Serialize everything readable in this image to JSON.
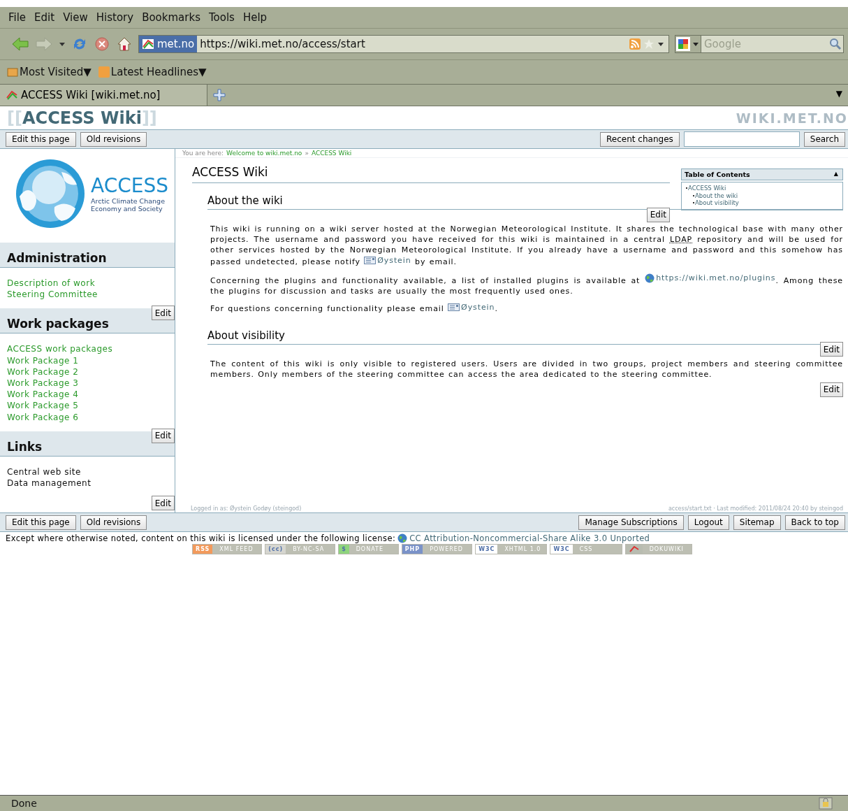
{
  "menu": [
    "File",
    "Edit",
    "View",
    "History",
    "Bookmarks",
    "Tools",
    "Help"
  ],
  "nav": {
    "site": "met.no",
    "url": "https://wiki.met.no/access/start",
    "search_placeholder": "Google"
  },
  "bookmarks": [
    "Most Visited▼",
    "Latest Headlines▼"
  ],
  "tabs": [
    {
      "label": "ACCESS Wiki [wiki.met.no]",
      "selected": true
    }
  ],
  "tab_list_arrow": "▼",
  "wiki": {
    "bracket_open": "[[",
    "title": "ACCESS Wiki",
    "bracket_close": "]]",
    "site_logo": "WIKI.MET.NO"
  },
  "top_left_buttons": [
    "Edit this page",
    "Old revisions"
  ],
  "top_right": {
    "recent": "Recent changes",
    "search_button": "Search"
  },
  "breadcrumb": {
    "label": "You are here:",
    "links": [
      "Welcome to wiki.met.no",
      "ACCESS Wiki"
    ],
    "separator": "»"
  },
  "logo": {
    "name": "ACCESS",
    "line1": "Arctic Climate Change",
    "line2": "Economy and Society"
  },
  "sidebar": [
    {
      "title": "Administration",
      "items": [
        {
          "label": "Description of work",
          "kind": "link"
        },
        {
          "label": "Steering Committee",
          "kind": "link"
        }
      ]
    },
    {
      "title": "Work packages",
      "edit": "Edit",
      "items": [
        {
          "label": "ACCESS work packages",
          "kind": "link"
        },
        {
          "label": "Work Package 1",
          "kind": "link"
        },
        {
          "label": "Work Package 2",
          "kind": "link"
        },
        {
          "label": "Work Package 3",
          "kind": "link"
        },
        {
          "label": "Work Package 4",
          "kind": "link"
        },
        {
          "label": "Work Package 5",
          "kind": "link"
        },
        {
          "label": "Work Package 6",
          "kind": "link"
        }
      ]
    },
    {
      "title": "Links",
      "edit": "Edit",
      "items": [
        {
          "label": "Central web site",
          "kind": "text"
        },
        {
          "label": "Data management",
          "kind": "text"
        }
      ]
    }
  ],
  "sidebar_end_edit": "Edit",
  "page_title": "ACCESS Wiki",
  "toc": {
    "title": "Table of Contents",
    "toggle": "▲",
    "entries": [
      {
        "label": "ACCESS Wiki",
        "children": [
          {
            "label": "About the wiki"
          },
          {
            "label": "About visibility"
          }
        ]
      }
    ]
  },
  "sections": [
    {
      "edit": "Edit",
      "heading": "About the wiki",
      "paragraphs": [
        [
          {
            "kind": "text",
            "text": "This wiki is running on a wiki server hosted at the Norwegian Meteorological Institute. It shares the technological base with many other projects. The username and password you have received for this wiki is maintained in a central "
          },
          {
            "kind": "abbr",
            "text": "LDAP"
          },
          {
            "kind": "text",
            "text": " repository and will be used for other services hosted by the Norwegian Meteorological Institute. If you already have a username and password and this somehow has passed undetected, please notify "
          },
          {
            "kind": "email",
            "text": "Øystein"
          },
          {
            "kind": "text",
            "text": " by email."
          }
        ],
        [
          {
            "kind": "text",
            "text": "Concerning the plugins and functionality available, a list of installed plugins is available at "
          },
          {
            "kind": "url",
            "text": "https://wiki.met.no/plugins"
          },
          {
            "kind": "text",
            "text": ". Among these the plugins for discussion and tasks are usually the most frequently used ones."
          }
        ],
        [
          {
            "kind": "text",
            "text": "For questions concerning functionality please email "
          },
          {
            "kind": "email",
            "text": "Øystein"
          },
          {
            "kind": "text",
            "text": "."
          }
        ]
      ]
    },
    {
      "edit": "Edit",
      "heading": "About visibility",
      "paragraphs": [
        [
          {
            "kind": "text",
            "text": "The content of this wiki is only visible to registered users. Users are divided in two groups, project members and steering committee members. Only members of the steering committee can access the area dedicated to the steering committee."
          }
        ]
      ]
    }
  ],
  "content_end_edit": "Edit",
  "meta": {
    "user": "Logged in as: Øystein Godøy (steingod)",
    "modified": "access/start.txt · Last modified: 2011/08/24 20:40 by steingod"
  },
  "bottom_left_buttons": [
    "Edit this page",
    "Old revisions"
  ],
  "bottom_right_buttons": [
    "Manage Subscriptions",
    "Logout",
    "Sitemap",
    "Back to top"
  ],
  "license": {
    "text": "Except where otherwise noted, content on this wiki is licensed under the following license:",
    "link": "CC Attribution-Noncommercial-Share Alike 3.0 Unported"
  },
  "badges": [
    {
      "left": "RSS",
      "right": "XML FEED",
      "color": "#f29a5c"
    },
    {
      "left": "(cc)",
      "right": "BY-NC-SA",
      "color": "#d6d6d0"
    },
    {
      "left": "$",
      "right": "DONATE",
      "color": "#8fd47d"
    },
    {
      "left": "PHP",
      "right": "POWERED",
      "color": "#7a92c8"
    },
    {
      "left": "W3C",
      "right": "XHTML 1.0",
      "color": "#ffffff"
    },
    {
      "left": "W3C",
      "right": "CSS",
      "color": "#ffffff"
    },
    {
      "right": "DOKUWIKI",
      "color": "#b8bcb0"
    }
  ],
  "status": "Done"
}
